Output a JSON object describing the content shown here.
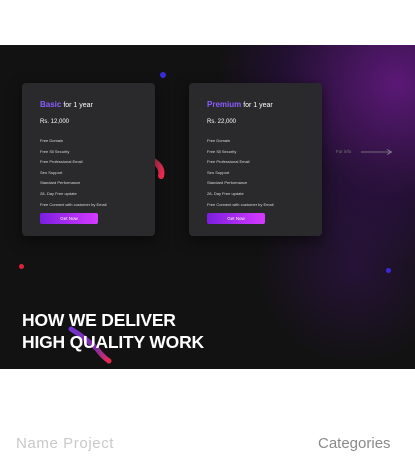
{
  "hero": {
    "cards": [
      {
        "plan_name": "Basic",
        "plan_period": "for 1 year",
        "price": "Rs. 12,000",
        "features": [
          "Free Domain",
          "Free Sll Security",
          "Free Professional Email",
          "Seo Support",
          "Standard Performance",
          "28- Day Free update",
          "Free Connect with customer by Email"
        ],
        "button_label": "Get Now"
      },
      {
        "plan_name": "Premium",
        "plan_period": "for 1 year",
        "price": "Rs. 22,000",
        "features": [
          "Free Domain",
          "Free Sll Security",
          "Free Professional Email",
          "Seo Support",
          "Standard Performance",
          "28- Day Free update",
          "Free Connect with customer by Email"
        ],
        "button_label": "Get Now"
      }
    ],
    "more_label": "For info",
    "headline_line1": "HOW WE DELIVER",
    "headline_line2": "HIGH QUALITY WORK"
  },
  "footer": {
    "name_label": "Name Project",
    "categories_label": "Categories"
  },
  "colors": {
    "background": "#121212",
    "accent_purple": "#8a5cff",
    "button_gradient_start": "#7b1fe0",
    "button_gradient_end": "#d63aff"
  },
  "icons": [
    "arrow-right-icon"
  ]
}
